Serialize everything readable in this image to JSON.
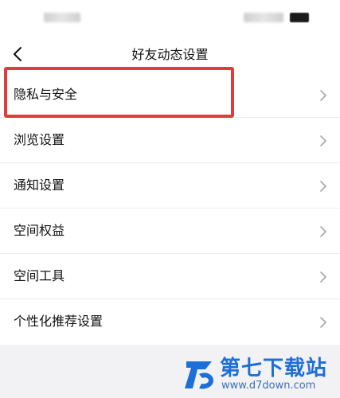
{
  "nav": {
    "title": "好友动态设置",
    "back_icon": "chevron-left-icon"
  },
  "settings": {
    "items": [
      {
        "label": "隐私与安全",
        "icon": "chevron-right-icon",
        "highlighted": true
      },
      {
        "label": "浏览设置",
        "icon": "chevron-right-icon"
      },
      {
        "label": "通知设置",
        "icon": "chevron-right-icon"
      },
      {
        "label": "空间权益",
        "icon": "chevron-right-icon"
      },
      {
        "label": "空间工具",
        "icon": "chevron-right-icon"
      },
      {
        "label": "个性化推荐设置",
        "icon": "chevron-right-icon"
      }
    ]
  },
  "watermark": {
    "title": "第七下载站",
    "url": "www.d7down.com"
  },
  "colors": {
    "highlight": "#e23b3b",
    "watermark_blue": "#1d6fd8",
    "bottom_bg": "#f2f2f4"
  }
}
